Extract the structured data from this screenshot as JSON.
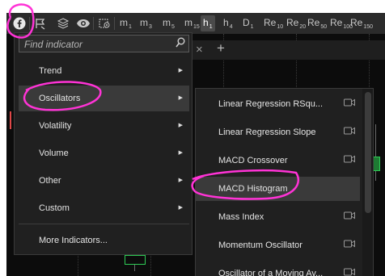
{
  "toolbar": {
    "icons": [
      "facebook-icon",
      "flag-icon",
      "layers-icon",
      "eye-icon",
      "settings-icon"
    ],
    "timeframes": [
      {
        "main": "m",
        "sub": "1",
        "active": false
      },
      {
        "main": "m",
        "sub": "3",
        "active": false
      },
      {
        "main": "m",
        "sub": "5",
        "active": false
      },
      {
        "main": "m",
        "sub": "15",
        "active": false
      },
      {
        "main": "h",
        "sub": "1",
        "active": true
      },
      {
        "main": "h",
        "sub": "4",
        "active": false
      },
      {
        "main": "D",
        "sub": "1",
        "active": false
      },
      {
        "main": "Re",
        "sub": "10",
        "active": false
      },
      {
        "main": "Re",
        "sub": "20",
        "active": false
      },
      {
        "main": "Re",
        "sub": "50",
        "active": false
      },
      {
        "main": "Re",
        "sub": "100",
        "active": false
      },
      {
        "main": "Re",
        "sub": "150",
        "active": false
      }
    ]
  },
  "tabs": {
    "close_glyph": "×",
    "add_glyph": "+"
  },
  "indicator_menu": {
    "search_placeholder": "Find indicator",
    "items": [
      {
        "label": "Trend",
        "has_submenu": true,
        "highlighted": false
      },
      {
        "label": "Oscillators",
        "has_submenu": true,
        "highlighted": true
      },
      {
        "label": "Volatility",
        "has_submenu": true,
        "highlighted": false
      },
      {
        "label": "Volume",
        "has_submenu": true,
        "highlighted": false
      },
      {
        "label": "Other",
        "has_submenu": true,
        "highlighted": false
      },
      {
        "label": "Custom",
        "has_submenu": true,
        "highlighted": false
      }
    ],
    "footer_item": "More Indicators..."
  },
  "oscillators_submenu": {
    "items": [
      {
        "label": "Linear Regression RSqu...",
        "video": true,
        "highlighted": false
      },
      {
        "label": "Linear Regression Slope",
        "video": true,
        "highlighted": false
      },
      {
        "label": "MACD Crossover",
        "video": true,
        "highlighted": false
      },
      {
        "label": "MACD Histogram",
        "video": false,
        "highlighted": true
      },
      {
        "label": "Mass Index",
        "video": true,
        "highlighted": false
      },
      {
        "label": "Momentum Oscillator",
        "video": true,
        "highlighted": false
      },
      {
        "label": "Oscillator of a Moving Av...",
        "video": true,
        "highlighted": false
      }
    ]
  },
  "colors": {
    "annotation": "#ff33d6",
    "menu_bg": "#202020",
    "highlight": "#3a3a3a",
    "candle_up": "#2ecc55",
    "candle_down": "#e04848"
  }
}
